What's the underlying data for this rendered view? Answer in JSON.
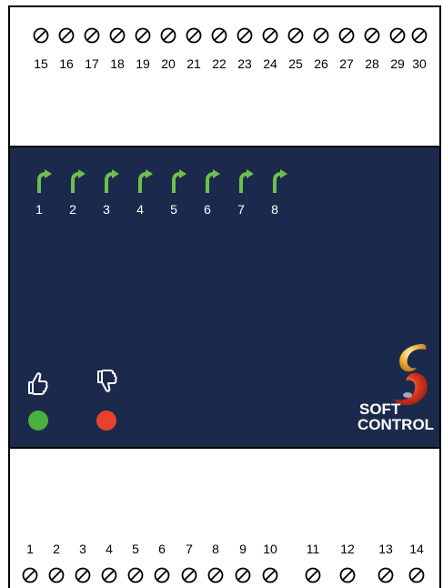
{
  "top_terminals": [
    "15",
    "16",
    "17",
    "18",
    "19",
    "20",
    "21",
    "22",
    "23",
    "24",
    "25",
    "26",
    "27",
    "28",
    "29",
    "30"
  ],
  "bottom_terminals": [
    "1",
    "2",
    "3",
    "4",
    "5",
    "6",
    "7",
    "8",
    "9",
    "10",
    "11",
    "12",
    "13",
    "14"
  ],
  "relays": [
    "1",
    "2",
    "3",
    "4",
    "5",
    "6",
    "7",
    "8"
  ],
  "status": {
    "ok_led_color": "#4caf3e",
    "fault_led_color": "#e8412e",
    "ok_icon": "thumbs-up-icon",
    "fault_icon": "thumbs-down-icon"
  },
  "colors": {
    "panel": "#1b2a4c",
    "relay_arrow": "#6fbf4a"
  },
  "logo": {
    "line1": "SOFT",
    "line2": "CONTROL"
  }
}
